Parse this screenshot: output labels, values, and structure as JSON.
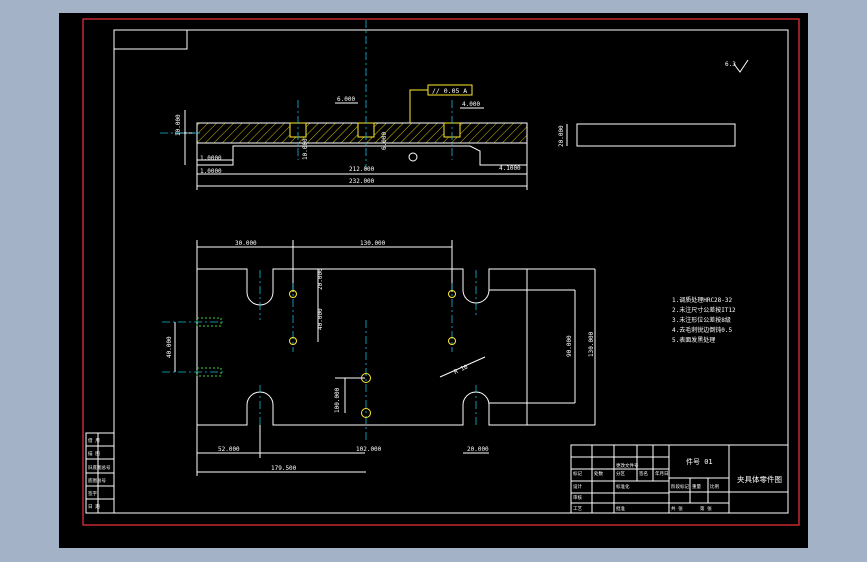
{
  "drawing": {
    "title_block": {
      "drawing_name": "夹具体零件图",
      "part_label": "件号 01"
    },
    "roughness_symbol": "6.3",
    "section_view": {
      "thickness_left": "10.000",
      "thickness_mid": "10.000",
      "thickness_right": "1.0000",
      "thickness_bottom": "1.0000",
      "inner_length": "212.000",
      "overall_length": "232.000",
      "slot_width": "6.000",
      "right_width": "4.000",
      "small_dim": "6.000",
      "right_bottom_dim": "4.1000",
      "end_view_dim": "20.000",
      "tolerance_frame": "// 0.05 A",
      "datum": "A"
    },
    "plan_view": {
      "left_offset": "30.000",
      "top_span": "130.000",
      "hole_offset": "20.000",
      "hole_pitch": "40.000",
      "left_spacing": "40.000",
      "center_height": "100.000",
      "inner_height": "90.000",
      "overall_height": "130.000",
      "bottom_left": "52.000",
      "bottom_center": "102.000",
      "bottom_right": "20.000",
      "bottom_overall": "179.500",
      "chamfer_label": "R 10"
    },
    "notes": [
      "1.调质处理HRC28-32",
      "2.未注尺寸公差按IT12",
      "3.未注形位公差按8级",
      "4.去毛刺锐边倒钝0.5",
      "5.表面发黑处理"
    ],
    "left_strip_labels": [
      "借 用",
      "描 图",
      "旧底图总号",
      "底图总号",
      "签字",
      "日 期"
    ],
    "table_small_texts": [
      "标记",
      "处数",
      "分区",
      "更改文件号",
      "签名",
      "年月日",
      "设计",
      "标准化",
      "审核",
      "工艺",
      "批准",
      "阶段标记",
      "重量",
      "比例",
      "共 张",
      "第 张"
    ],
    "colors": {
      "frame_red": "#e0303a",
      "line_white": "#ffffff",
      "center_cyan": "#16b8d6",
      "thread_green": "#3ad13a",
      "hole_yellow": "#ffea2e",
      "hatch_yellow": "#d8c000"
    }
  }
}
